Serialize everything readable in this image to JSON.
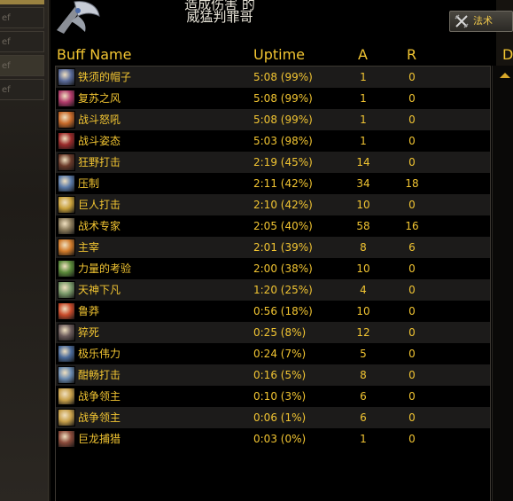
{
  "side_tabs": [
    "ef",
    "ef",
    "ef",
    "ef"
  ],
  "header": {
    "title_line1": "造成伤害 的",
    "title_line2": "威猛判罪哥",
    "spell_button": "法术"
  },
  "columns": {
    "name": "Buff Name",
    "uptime": "Uptime",
    "a": "A",
    "r": "R",
    "d": "D"
  },
  "rows": [
    {
      "name": "铁须的帽子",
      "uptime": "5:08 (99%)",
      "a": "1",
      "r": "0",
      "icon": "helmet-icon",
      "color": "#5a6b9a"
    },
    {
      "name": "复苏之风",
      "uptime": "5:08 (99%)",
      "a": "1",
      "r": "0",
      "icon": "wind-icon",
      "color": "#b03a6a"
    },
    {
      "name": "战斗怒吼",
      "uptime": "5:08 (99%)",
      "a": "1",
      "r": "0",
      "icon": "shout-icon",
      "color": "#c86a2a"
    },
    {
      "name": "战斗姿态",
      "uptime": "5:03 (98%)",
      "a": "1",
      "r": "0",
      "icon": "stance-icon",
      "color": "#9a2a2a"
    },
    {
      "name": "狂野打击",
      "uptime": "2:19 (45%)",
      "a": "14",
      "r": "0",
      "icon": "strike-icon",
      "color": "#6a3a2a"
    },
    {
      "name": "压制",
      "uptime": "2:11 (42%)",
      "a": "34",
      "r": "18",
      "icon": "overpower-icon",
      "color": "#5a7aa8"
    },
    {
      "name": "巨人打击",
      "uptime": "2:10 (42%)",
      "a": "10",
      "r": "0",
      "icon": "shield-icon",
      "color": "#c8a03a"
    },
    {
      "name": "战术专家",
      "uptime": "2:05 (40%)",
      "a": "58",
      "r": "16",
      "icon": "tactician-icon",
      "color": "#8a7a5a"
    },
    {
      "name": "主宰",
      "uptime": "2:01 (39%)",
      "a": "8",
      "r": "6",
      "icon": "master-icon",
      "color": "#d07a2a"
    },
    {
      "name": "力量的考验",
      "uptime": "2:00 (38%)",
      "a": "10",
      "r": "0",
      "icon": "trial-icon",
      "color": "#5a8a3a"
    },
    {
      "name": "天神下凡",
      "uptime": "1:20 (25%)",
      "a": "4",
      "r": "0",
      "icon": "avatar-icon",
      "color": "#7a9a6a"
    },
    {
      "name": "鲁莽",
      "uptime": "0:56 (18%)",
      "a": "10",
      "r": "0",
      "icon": "recklessness-icon",
      "color": "#c84a2a"
    },
    {
      "name": "猝死",
      "uptime": "0:25 (8%)",
      "a": "12",
      "r": "0",
      "icon": "sudden-death-icon",
      "color": "#6a5a5a"
    },
    {
      "name": "极乐伟力",
      "uptime": "0:24 (7%)",
      "a": "5",
      "r": "0",
      "icon": "bliss-icon",
      "color": "#4a6a9a"
    },
    {
      "name": "酣畅打击",
      "uptime": "0:16 (5%)",
      "a": "8",
      "r": "0",
      "icon": "fluid-strike-icon",
      "color": "#6a8ab0"
    },
    {
      "name": "战争领主",
      "uptime": "0:10 (3%)",
      "a": "6",
      "r": "0",
      "icon": "warlord-icon",
      "color": "#c8a04a"
    },
    {
      "name": "战争领主",
      "uptime": "0:06 (1%)",
      "a": "6",
      "r": "0",
      "icon": "warlord-icon",
      "color": "#c8a04a"
    },
    {
      "name": "巨龙捕猎",
      "uptime": "0:03 (0%)",
      "a": "1",
      "r": "0",
      "icon": "dragon-icon",
      "color": "#8a4a3a"
    }
  ]
}
